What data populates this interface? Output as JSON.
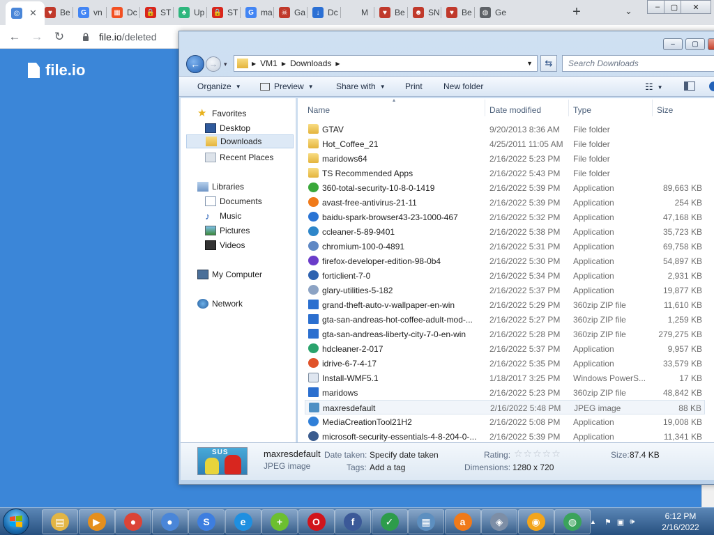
{
  "browser": {
    "tabs": [
      {
        "label": "",
        "favicon": "chrome-icon",
        "active": true
      },
      {
        "label": "Be",
        "favicon": "shield-icon"
      },
      {
        "label": "vn",
        "favicon": "google-icon"
      },
      {
        "label": "Dc",
        "favicon": "microsoft-icon"
      },
      {
        "label": "ST",
        "favicon": "lock-icon"
      },
      {
        "label": "Up",
        "favicon": "leaf-icon"
      },
      {
        "label": "ST",
        "favicon": "lock-icon"
      },
      {
        "label": "ma",
        "favicon": "google-icon"
      },
      {
        "label": "Ga",
        "favicon": "skull-icon"
      },
      {
        "label": "Dc",
        "favicon": "download-icon"
      },
      {
        "label": "M",
        "favicon": "blank-icon"
      },
      {
        "label": "Be",
        "favicon": "shield-icon"
      },
      {
        "label": "SN",
        "favicon": "mask-icon"
      },
      {
        "label": "Be",
        "favicon": "shield-icon"
      },
      {
        "label": "Ge",
        "favicon": "globe-icon"
      }
    ],
    "url_host": "file.io",
    "url_path": "/deleted"
  },
  "page": {
    "logo_text": "file.io"
  },
  "explorer": {
    "breadcrumb": [
      "VM1",
      "Downloads"
    ],
    "search_placeholder": "Search Downloads",
    "commands": {
      "organize": "Organize",
      "preview": "Preview",
      "share": "Share with",
      "print": "Print",
      "new_folder": "New folder"
    },
    "nav": {
      "favorites": "Favorites",
      "desktop": "Desktop",
      "downloads": "Downloads",
      "recent": "Recent Places",
      "libraries": "Libraries",
      "documents": "Documents",
      "music": "Music",
      "pictures": "Pictures",
      "videos": "Videos",
      "computer": "My Computer",
      "network": "Network"
    },
    "columns": {
      "name": "Name",
      "date": "Date modified",
      "type": "Type",
      "size": "Size"
    },
    "files": [
      {
        "name": "GTAV",
        "date": "9/20/2013 8:36 AM",
        "type": "File folder",
        "size": "",
        "kind": "folder"
      },
      {
        "name": "Hot_Coffee_21",
        "date": "4/25/2011 11:05 AM",
        "type": "File folder",
        "size": "",
        "kind": "folder"
      },
      {
        "name": "maridows64",
        "date": "2/16/2022 5:23 PM",
        "type": "File folder",
        "size": "",
        "kind": "folder"
      },
      {
        "name": "TS Recommended Apps",
        "date": "2/16/2022 5:43 PM",
        "type": "File folder",
        "size": "",
        "kind": "folder"
      },
      {
        "name": "360-total-security-10-8-0-1419",
        "date": "2/16/2022 5:39 PM",
        "type": "Application",
        "size": "89,663 KB",
        "kind": "app",
        "color": "#3aa83a"
      },
      {
        "name": "avast-free-antivirus-21-11",
        "date": "2/16/2022 5:39 PM",
        "type": "Application",
        "size": "254 KB",
        "kind": "app",
        "color": "#f07a1a"
      },
      {
        "name": "baidu-spark-browser43-23-1000-467",
        "date": "2/16/2022 5:32 PM",
        "type": "Application",
        "size": "47,168 KB",
        "kind": "app",
        "color": "#2a74d4"
      },
      {
        "name": "ccleaner-5-89-9401",
        "date": "2/16/2022 5:38 PM",
        "type": "Application",
        "size": "35,723 KB",
        "kind": "app",
        "color": "#2e86c9"
      },
      {
        "name": "chromium-100-0-4891",
        "date": "2/16/2022 5:31 PM",
        "type": "Application",
        "size": "69,758 KB",
        "kind": "app",
        "color": "#5f88c4"
      },
      {
        "name": "firefox-developer-edition-98-0b4",
        "date": "2/16/2022 5:30 PM",
        "type": "Application",
        "size": "54,897 KB",
        "kind": "app",
        "color": "#6a3cc9"
      },
      {
        "name": "forticlient-7-0",
        "date": "2/16/2022 5:34 PM",
        "type": "Application",
        "size": "2,931 KB",
        "kind": "app",
        "color": "#2f63b0"
      },
      {
        "name": "glary-utilities-5-182",
        "date": "2/16/2022 5:37 PM",
        "type": "Application",
        "size": "19,877 KB",
        "kind": "app",
        "color": "#8ca3c4"
      },
      {
        "name": "grand-theft-auto-v-wallpaper-en-win",
        "date": "2/16/2022 5:29 PM",
        "type": "360zip ZIP file",
        "size": "11,610 KB",
        "kind": "zip",
        "color": "#2b6fcf"
      },
      {
        "name": "gta-san-andreas-hot-coffee-adult-mod-...",
        "date": "2/16/2022 5:27 PM",
        "type": "360zip ZIP file",
        "size": "1,259 KB",
        "kind": "zip",
        "color": "#2b6fcf"
      },
      {
        "name": "gta-san-andreas-liberty-city-7-0-en-win",
        "date": "2/16/2022 5:28 PM",
        "type": "360zip ZIP file",
        "size": "279,275 KB",
        "kind": "zip",
        "color": "#2b6fcf"
      },
      {
        "name": "hdcleaner-2-017",
        "date": "2/16/2022 5:37 PM",
        "type": "Application",
        "size": "9,957 KB",
        "kind": "app",
        "color": "#2aa36c"
      },
      {
        "name": "idrive-6-7-4-17",
        "date": "2/16/2022 5:35 PM",
        "type": "Application",
        "size": "33,579 KB",
        "kind": "app",
        "color": "#e0532a"
      },
      {
        "name": "Install-WMF5.1",
        "date": "1/18/2017 3:25 PM",
        "type": "Windows PowerS...",
        "size": "17 KB",
        "kind": "script",
        "color": "#dfe6f0"
      },
      {
        "name": "maridows",
        "date": "2/16/2022 5:23 PM",
        "type": "360zip ZIP file",
        "size": "48,842 KB",
        "kind": "zip",
        "color": "#2b6fcf"
      },
      {
        "name": "maxresdefault",
        "date": "2/16/2022 5:48 PM",
        "type": "JPEG image",
        "size": "88 KB",
        "kind": "image",
        "color": "#4d8fc4",
        "selected": true
      },
      {
        "name": "MediaCreationTool21H2",
        "date": "2/16/2022 5:08 PM",
        "type": "Application",
        "size": "19,008 KB",
        "kind": "app",
        "color": "#2f7fd8"
      },
      {
        "name": "microsoft-security-essentials-4-8-204-0-...",
        "date": "2/16/2022 5:39 PM",
        "type": "Application",
        "size": "11,341 KB",
        "kind": "app",
        "color": "#3b5c8e"
      }
    ],
    "details": {
      "filename": "maxresdefault",
      "filetype": "JPEG image",
      "date_taken_label": "Date taken:",
      "date_taken_value": "Specify date taken",
      "tags_label": "Tags:",
      "tags_value": "Add a tag",
      "rating_label": "Rating:",
      "dimensions_label": "Dimensions:",
      "dimensions_value": "1280 x 720",
      "size_label": "Size:",
      "size_value": "87.4 KB",
      "thumb_text": "SUS",
      "rating": 0
    }
  },
  "taskbar": {
    "apps": [
      {
        "name": "file-explorer-icon",
        "color": "#e2b544",
        "glyph": "▤"
      },
      {
        "name": "media-player-icon",
        "color": "#e58f1d",
        "glyph": "▶"
      },
      {
        "name": "chrome-icon",
        "color": "#db4437",
        "glyph": "●"
      },
      {
        "name": "chromium-icon",
        "color": "#4a86d8",
        "glyph": "●"
      },
      {
        "name": "baidu-icon",
        "color": "#3d7ee0",
        "glyph": "S"
      },
      {
        "name": "internet-explorer-icon",
        "color": "#1f8fe0",
        "glyph": "e"
      },
      {
        "name": "add-icon",
        "color": "#6cbf2f",
        "glyph": "+"
      },
      {
        "name": "opera-icon",
        "color": "#d1151c",
        "glyph": "O"
      },
      {
        "name": "facebook-icon",
        "color": "#3b5998",
        "glyph": "f"
      },
      {
        "name": "shield-app-icon",
        "color": "#2d9c4b",
        "glyph": "✓"
      },
      {
        "name": "control-panel-icon",
        "color": "#5d8fc0",
        "glyph": "▦"
      },
      {
        "name": "avast-icon",
        "color": "#f07a1a",
        "glyph": "a"
      },
      {
        "name": "network-tool-icon",
        "color": "#7d8ea6",
        "glyph": "◈"
      },
      {
        "name": "lock-app-icon",
        "color": "#f3a51b",
        "glyph": "◉"
      },
      {
        "name": "globe-app-icon",
        "color": "#3aa35c",
        "glyph": "◍"
      }
    ],
    "time": "6:12 PM",
    "date": "2/16/2022"
  }
}
